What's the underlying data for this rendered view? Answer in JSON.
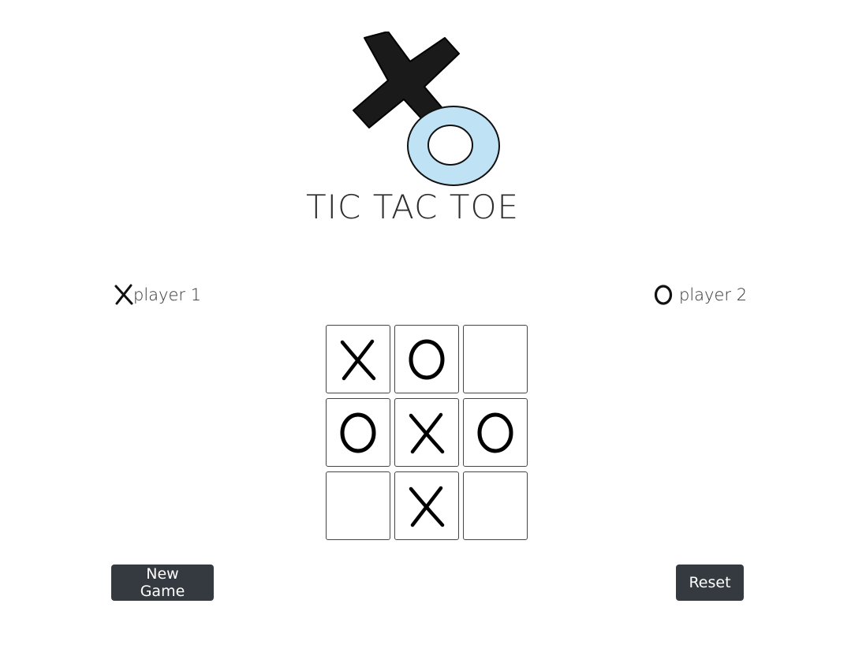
{
  "title": "TIC TAC TOE",
  "players": {
    "player1": {
      "mark": "X",
      "label": "player 1"
    },
    "player2": {
      "mark": "O",
      "label": "player 2"
    }
  },
  "board": [
    "X",
    "O",
    "",
    "O",
    "X",
    "O",
    "",
    "X",
    ""
  ],
  "buttons": {
    "new_game": "New Game",
    "reset": "Reset"
  },
  "colors": {
    "button_bg": "#343a40",
    "logo_x": "#1a1a1a",
    "logo_o": "#bfe2f5"
  },
  "icons": {
    "logo": "x-and-o-logo-icon",
    "x": "x-mark-icon",
    "o": "o-mark-icon"
  }
}
